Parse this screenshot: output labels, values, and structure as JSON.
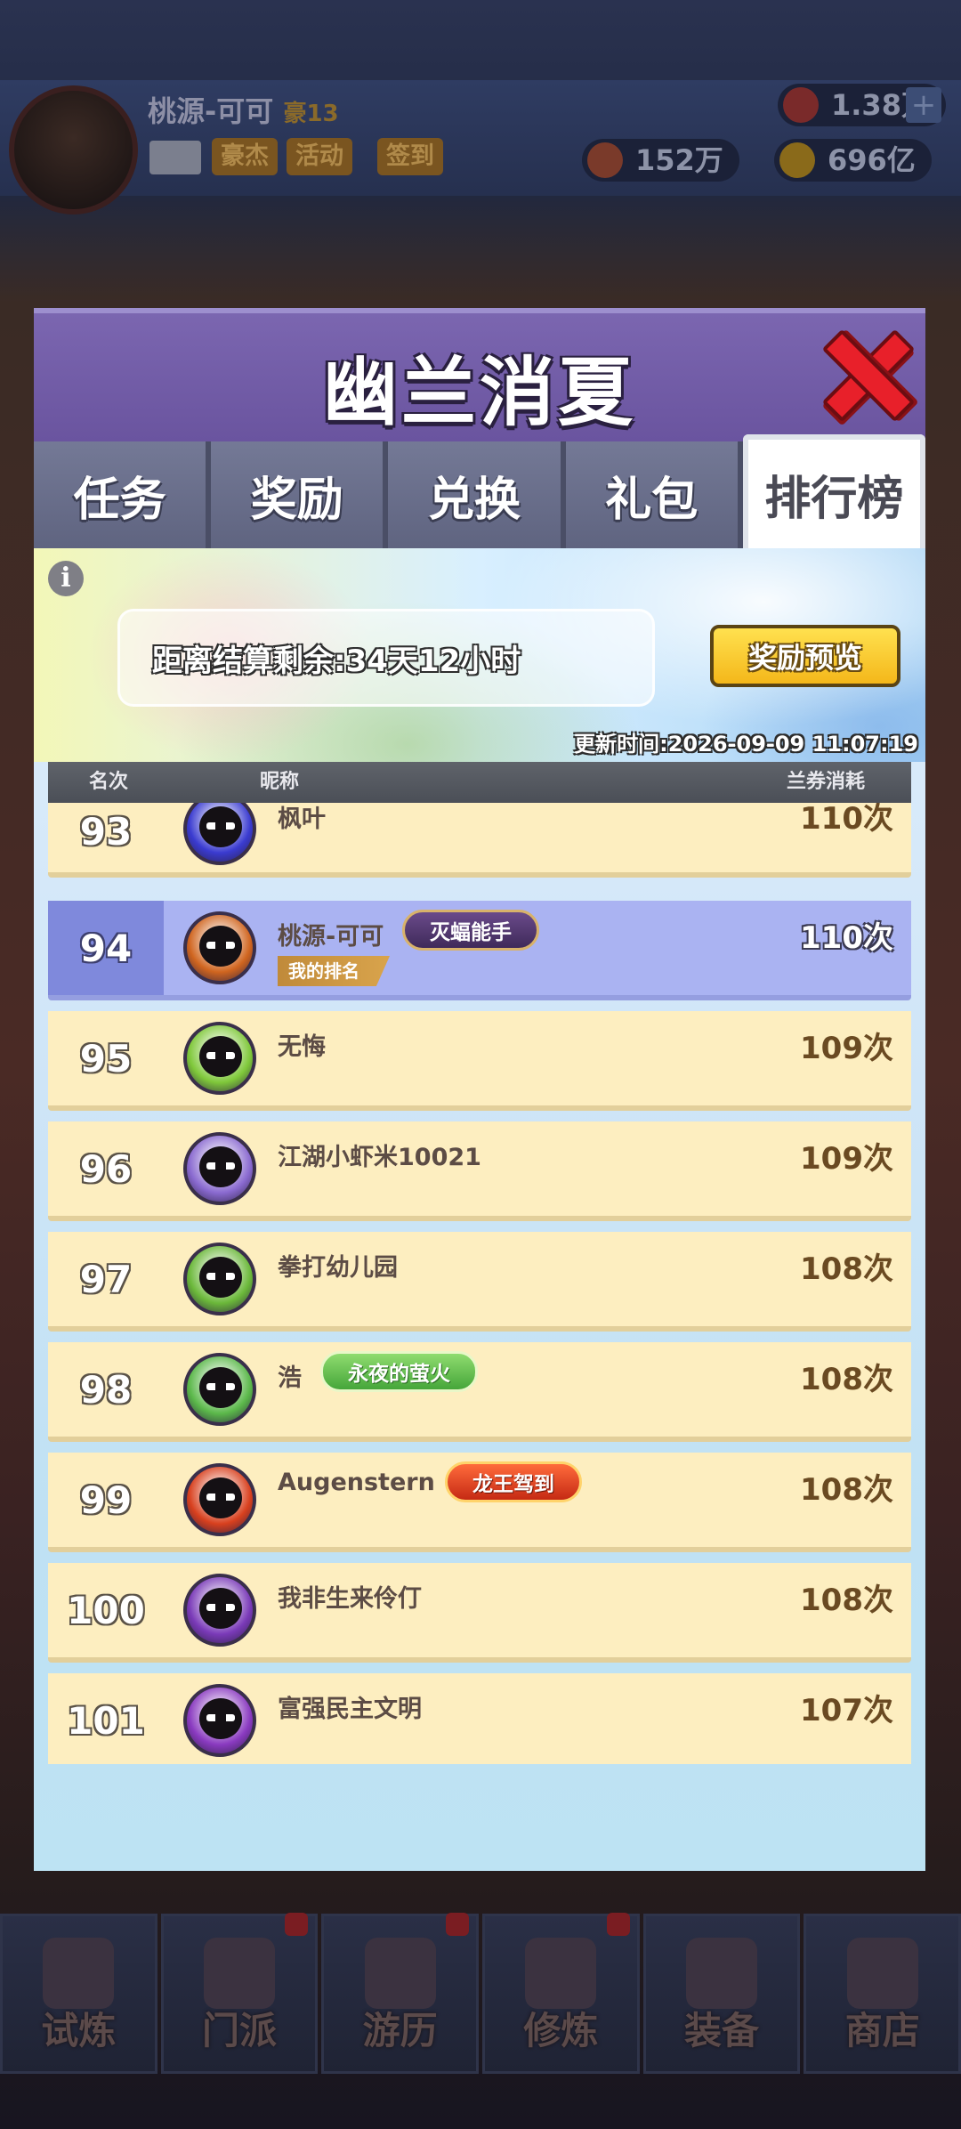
{
  "hud": {
    "player_name": "桃源-可可",
    "vip_level": "豪13",
    "tags": [
      "豪杰",
      "活动",
      "签到"
    ],
    "gems": "1.38万",
    "tickets": "152万",
    "gold": "696亿"
  },
  "modal": {
    "title": "幽兰消夏",
    "tabs": [
      "任务",
      "奖励",
      "兑换",
      "礼包",
      "排行榜"
    ],
    "active_tab": "排行榜",
    "countdown": "距离结算剩余:34天12小时",
    "preview_button": "奖励预览",
    "update_time": "更新时间:2026-09-09 11:07:19",
    "columns": {
      "rank": "名次",
      "name": "昵称",
      "cost": "兰券消耗"
    },
    "my_rank_tag": "我的排名",
    "rows": [
      {
        "rank": "93",
        "name": "枫叶",
        "count": "110次",
        "title": "",
        "me": false,
        "avatar_color": "#3a3bd0"
      },
      {
        "rank": "94",
        "name": "桃源-可可",
        "count": "110次",
        "title": "灭蝠能手",
        "title_style": "purple",
        "me": true,
        "avatar_color": "#d0651f"
      },
      {
        "rank": "95",
        "name": "无悔",
        "count": "109次",
        "title": "",
        "me": false,
        "avatar_color": "#7fc83a"
      },
      {
        "rank": "96",
        "name": "江湖小虾米10021",
        "count": "109次",
        "title": "",
        "me": false,
        "avatar_color": "#8a6ad0"
      },
      {
        "rank": "97",
        "name": "拳打幼儿园",
        "count": "108次",
        "title": "",
        "me": false,
        "avatar_color": "#6bb83a"
      },
      {
        "rank": "98",
        "name": "浩",
        "count": "108次",
        "title": "永夜的萤火",
        "title_style": "green",
        "me": false,
        "avatar_color": "#5bb84a"
      },
      {
        "rank": "99",
        "name": "Augenstern",
        "count": "108次",
        "title": "龙王驾到",
        "title_style": "red",
        "me": false,
        "avatar_color": "#d8401e"
      },
      {
        "rank": "100",
        "name": "我非生来伶仃",
        "count": "108次",
        "title": "",
        "me": false,
        "avatar_color": "#7a3ab8"
      },
      {
        "rank": "101",
        "name": "富强民主文明",
        "count": "107次",
        "title": "",
        "me": false,
        "avatar_color": "#8a3ac0"
      }
    ]
  },
  "bottom_nav": [
    "试炼",
    "门派",
    "游历",
    "修炼",
    "装备",
    "商店"
  ]
}
